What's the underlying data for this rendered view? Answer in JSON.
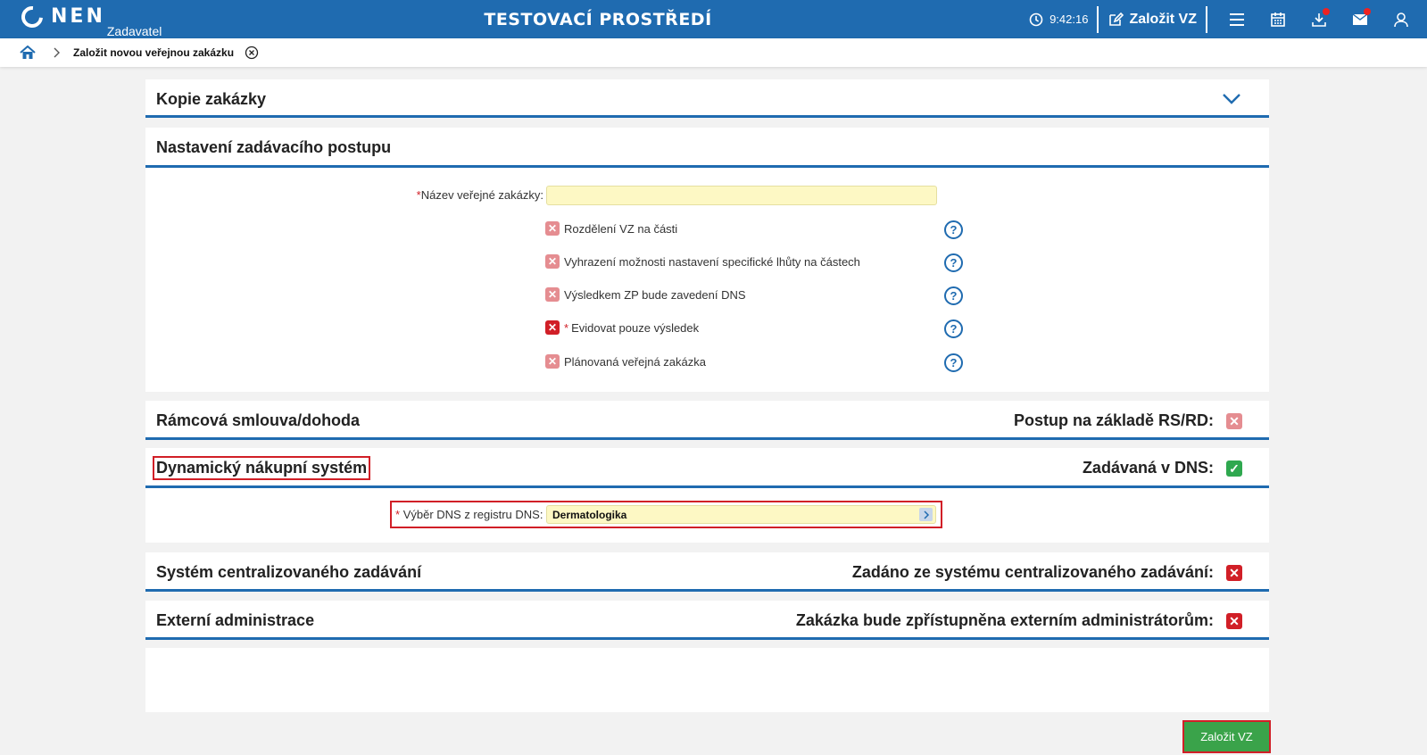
{
  "header": {
    "logo_text": "NEN",
    "logo_sub": "Zadavatel",
    "env_title": "TESTOVACÍ PROSTŘEDÍ",
    "time": "9:42:16",
    "create_label": "Založit VZ"
  },
  "breadcrumb": {
    "label": "Založit novou veřejnou zakázku"
  },
  "sections": {
    "kopie": {
      "title": "Kopie zakázky"
    },
    "nastaveni": {
      "title": "Nastavení zadávacího postupu",
      "name_label": "Název veřejné zakázky:",
      "name_value": "",
      "options": [
        {
          "label": "Rozdělení VZ na části",
          "checked": false,
          "required": false
        },
        {
          "label": "Vyhrazení možnosti nastavení specifické lhůty na částech",
          "checked": false,
          "required": false
        },
        {
          "label": "Výsledkem ZP bude zavedení DNS",
          "checked": false,
          "required": false
        },
        {
          "label": "Evidovat pouze výsledek",
          "checked": false,
          "required": true
        },
        {
          "label": "Plánovaná veřejná zakázka",
          "checked": false,
          "required": false
        }
      ]
    },
    "ramcova": {
      "title": "Rámcová smlouva/dohoda",
      "right_label": "Postup na základě RS/RD:",
      "checked": false
    },
    "dns": {
      "title": "Dynamický nákupní systém",
      "right_label": "Zadávaná v DNS:",
      "checked": true,
      "field_label": "Výběr DNS z registru DNS:",
      "field_value": "Dermatologika"
    },
    "centralizovane": {
      "title": "Systém centralizovaného zadávání",
      "right_label": "Zadáno ze systému centralizovaného zadávání:",
      "checked": false
    },
    "externi": {
      "title": "Externí administrace",
      "right_label": "Zakázka bude zpřístupněna externím administrátorům:",
      "checked": false
    }
  },
  "footer": {
    "submit_label": "Založit VZ"
  },
  "colors": {
    "brand": "#1f6bb0",
    "required": "#d11f27",
    "checked_green": "#2fa84f",
    "input_bg": "#fdf8c4"
  }
}
